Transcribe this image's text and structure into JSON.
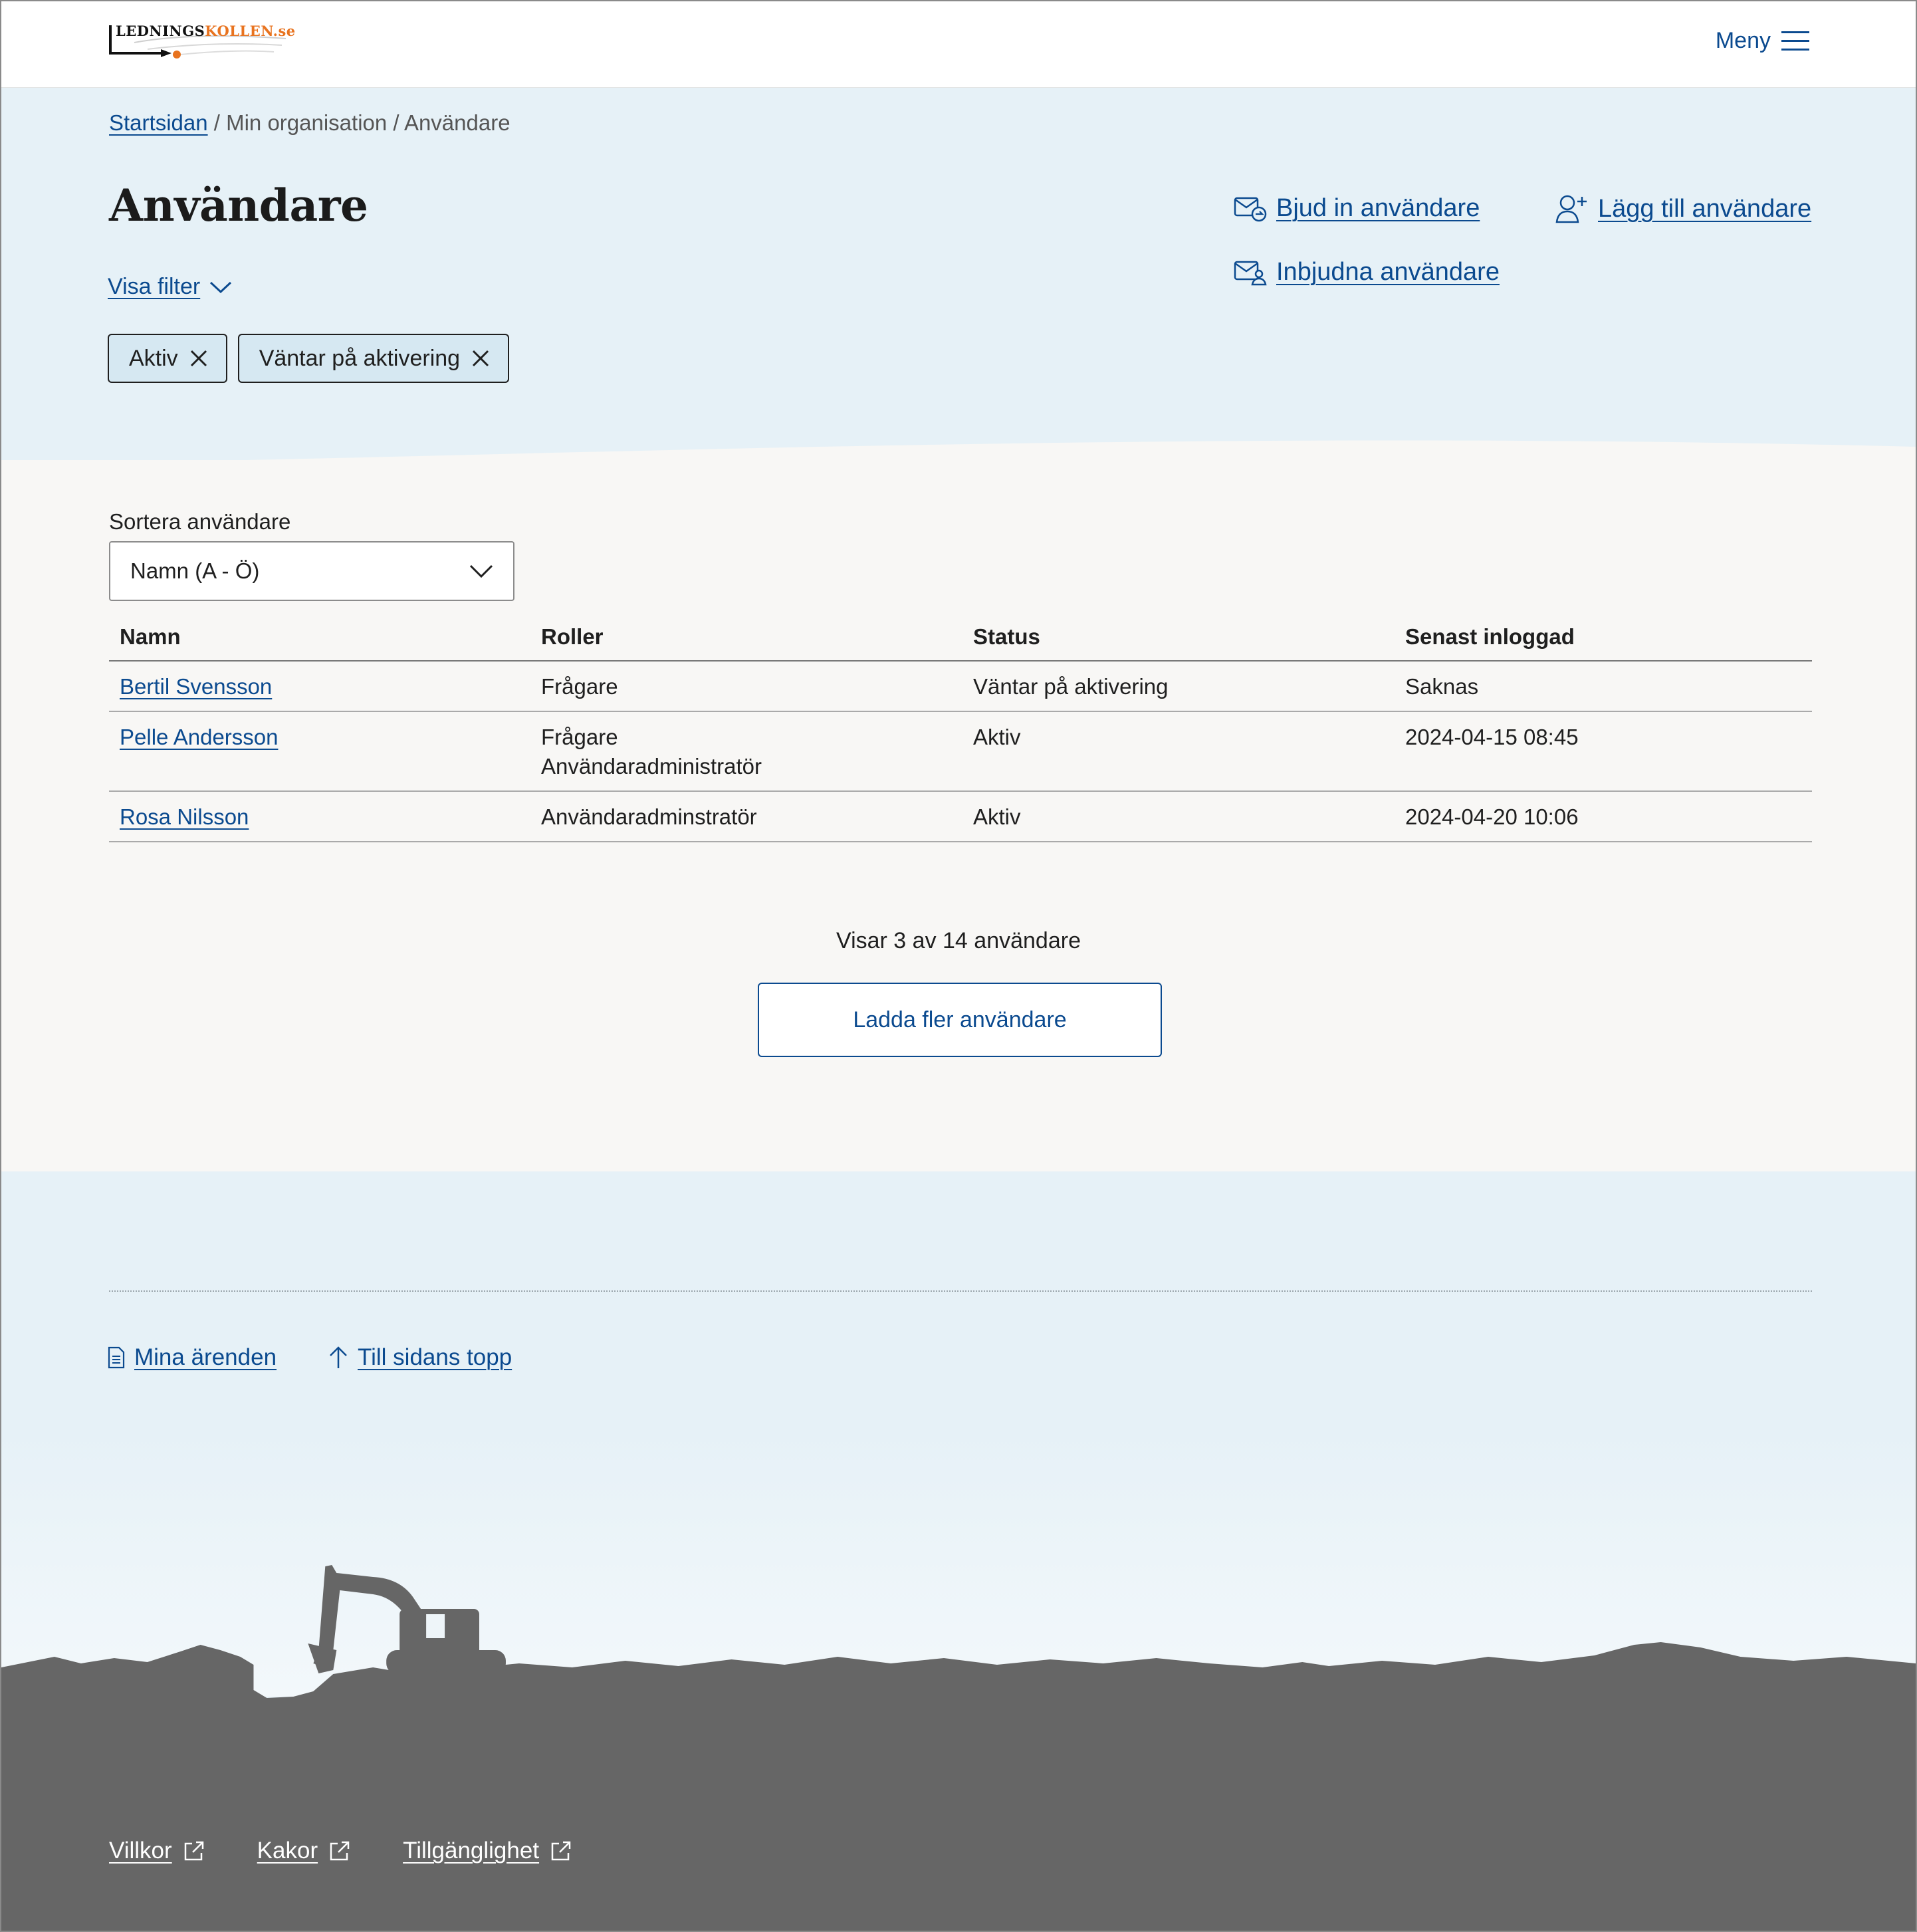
{
  "header": {
    "logo_part1": "LEDNINGS",
    "logo_part2": "KOLLEN.se",
    "menu_label": "Meny"
  },
  "breadcrumb": {
    "home": "Startsidan",
    "separator": " / ",
    "org": "Min organisation",
    "current": "Användare"
  },
  "page": {
    "title": "Användare",
    "filter_toggle": "Visa filter",
    "active_filters": [
      "Aktiv",
      "Väntar på aktivering"
    ],
    "actions": {
      "invite": "Bjud in användare",
      "add": "Lägg till användare",
      "invited": "Inbjudna användare"
    }
  },
  "sort": {
    "label": "Sortera användare",
    "selected": "Namn (A - Ö)"
  },
  "table": {
    "headers": [
      "Namn",
      "Roller",
      "Status",
      "Senast inloggad"
    ],
    "rows": [
      {
        "name": "Bertil Svensson",
        "roles": [
          "Frågare"
        ],
        "status": "Väntar på aktivering",
        "last_login": "Saknas"
      },
      {
        "name": "Pelle Andersson",
        "roles": [
          "Frågare",
          "Användaradministratör"
        ],
        "status": "Aktiv",
        "last_login": "2024-04-15 08:45"
      },
      {
        "name": "Rosa Nilsson",
        "roles": [
          "Användaradminstratör"
        ],
        "status": "Aktiv",
        "last_login": "2024-04-20 10:06"
      }
    ]
  },
  "pagination": {
    "count_text": "Visar 3 av 14 användare",
    "load_more": "Ladda fler användare"
  },
  "footer": {
    "my_cases": "Mina ärenden",
    "to_top": "Till sidans topp",
    "links": [
      "Villkor",
      "Kakor",
      "Tillgänglighet"
    ]
  },
  "colors": {
    "link": "#0b4a8f",
    "light_blue_bg": "#e6f1f7",
    "main_bg": "#f8f7f5",
    "ground": "#666666",
    "logo_accent": "#e8731f"
  }
}
